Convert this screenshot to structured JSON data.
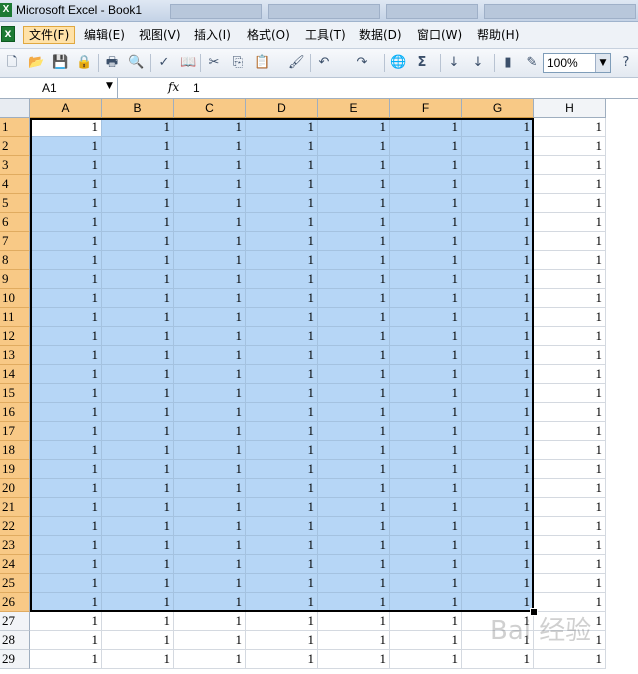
{
  "window": {
    "title": "Microsoft Excel - Book1"
  },
  "menu": [
    {
      "label": "文件(F)",
      "active": true
    },
    {
      "label": "编辑(E)",
      "active": false
    },
    {
      "label": "视图(V)",
      "active": false
    },
    {
      "label": "插入(I)",
      "active": false
    },
    {
      "label": "格式(O)",
      "active": false
    },
    {
      "label": "工具(T)",
      "active": false
    },
    {
      "label": "数据(D)",
      "active": false
    },
    {
      "label": "窗口(W)",
      "active": false
    },
    {
      "label": "帮助(H)",
      "active": false
    }
  ],
  "toolbar": {
    "icons": [
      "new-icon",
      "open-icon",
      "save-icon",
      "permission-icon",
      "print-icon",
      "print-preview-icon",
      "spelling-icon",
      "research-icon",
      "cut-icon",
      "copy-icon",
      "paste-icon",
      "format-painter-icon",
      "undo-icon",
      "redo-icon",
      "hyperlink-icon",
      "autosum-icon",
      "sort-ascending-icon",
      "sort-descending-icon",
      "chart-wizard-icon",
      "drawing-icon",
      "help-icon"
    ],
    "autosum_symbol": "Σ",
    "zoom": "100%"
  },
  "formula_bar": {
    "name_box": "A1",
    "fx_label": "fx",
    "value": "1"
  },
  "sheet": {
    "columns": [
      "A",
      "B",
      "C",
      "D",
      "E",
      "F",
      "G",
      "H"
    ],
    "selected_columns": [
      "A",
      "B",
      "C",
      "D",
      "E",
      "F",
      "G"
    ],
    "row_count": 29,
    "selected_rows": 26,
    "active_cell": "A1",
    "cell_value": "1"
  },
  "watermark": "Bai 经验",
  "colors": {
    "selection_fill": "#b6d6f6",
    "header_highlight": "#f8c986",
    "excel_green": "#1d7a34"
  }
}
